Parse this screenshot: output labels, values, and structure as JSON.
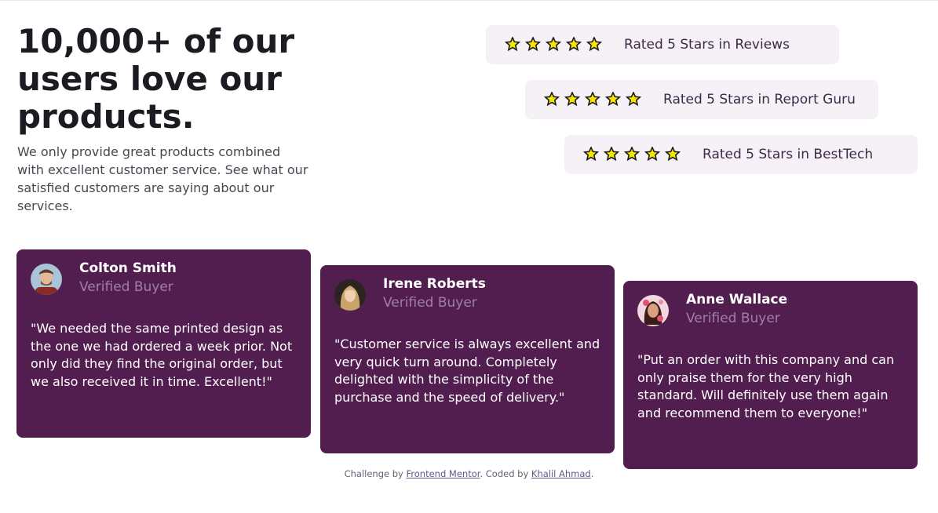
{
  "heading": "10,000+ of our users love our products.",
  "intro": "We only provide great products combined with excellent customer service. See what our satisfied customers are saying about our services.",
  "ratings": [
    {
      "label": "Rated 5 Stars in Reviews",
      "stars": 5
    },
    {
      "label": "Rated 5 Stars in Report Guru",
      "stars": 5
    },
    {
      "label": "Rated 5 Stars in BestTech",
      "stars": 5
    }
  ],
  "testimonials": [
    {
      "name": "Colton Smith",
      "role": "Verified Buyer",
      "quote": "\"We needed the same printed design as the one we had ordered a week prior. Not only did they find the original order, but we also received it in time. Excellent!\""
    },
    {
      "name": "Irene Roberts",
      "role": "Verified Buyer",
      "quote": "\"Customer service is always excellent and very quick turn around. Completely delighted with the simplicity of the purchase and the speed of delivery.\""
    },
    {
      "name": "Anne Wallace",
      "role": "Verified Buyer",
      "quote": "\"Put an order with this company and can only praise them for the very high standard. Will definitely use them again and recommend them to everyone!\""
    }
  ],
  "footer": {
    "prefix": "Challenge by ",
    "link1": "Frontend Mentor",
    "middle": ". Coded by ",
    "link2": "Khalil Ahmad",
    "suffix": "."
  },
  "colors": {
    "card_bg": "#521e50",
    "rating_bg": "#f6f1f6",
    "verified": "#a07fa3",
    "star_fill": "#f5e600"
  },
  "icons": {
    "star": "star-icon",
    "avatar": "avatar"
  }
}
